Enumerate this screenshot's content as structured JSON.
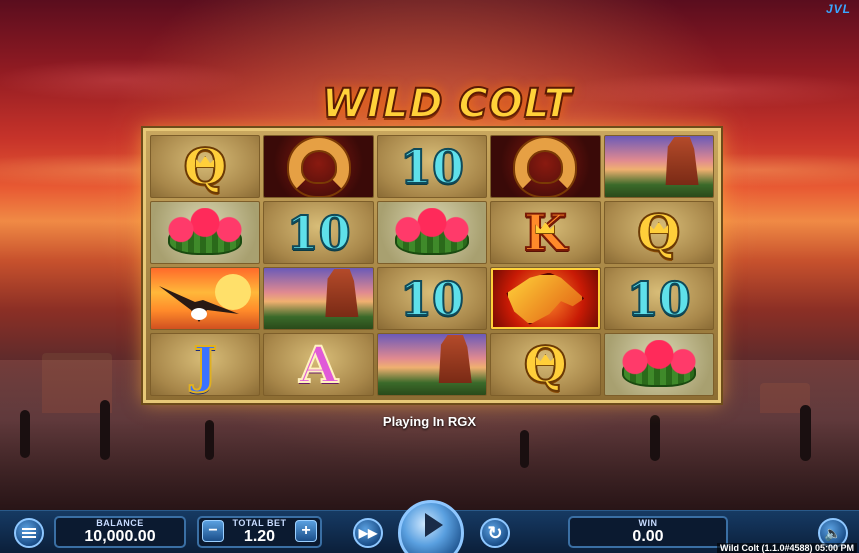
{
  "brand": {
    "logo_text": "JVL"
  },
  "game": {
    "title": "WILD COLT"
  },
  "reels": [
    [
      {
        "symbol": "Q",
        "type": "letter"
      },
      {
        "symbol": "cactus-flower",
        "type": "picture"
      },
      {
        "symbol": "eagle",
        "type": "picture"
      },
      {
        "symbol": "J",
        "type": "letter"
      }
    ],
    [
      {
        "symbol": "horseshoe",
        "type": "picture"
      },
      {
        "symbol": "10",
        "type": "letter"
      },
      {
        "symbol": "mesa",
        "type": "picture"
      },
      {
        "symbol": "A",
        "type": "letter"
      }
    ],
    [
      {
        "symbol": "10",
        "type": "letter"
      },
      {
        "symbol": "cactus-flower",
        "type": "picture"
      },
      {
        "symbol": "10",
        "type": "letter"
      },
      {
        "symbol": "mesa",
        "type": "picture"
      }
    ],
    [
      {
        "symbol": "horseshoe",
        "type": "picture"
      },
      {
        "symbol": "K",
        "type": "letter"
      },
      {
        "symbol": "wild-horse",
        "type": "picture"
      },
      {
        "symbol": "Q",
        "type": "letter"
      }
    ],
    [
      {
        "symbol": "mesa",
        "type": "picture"
      },
      {
        "symbol": "Q",
        "type": "letter"
      },
      {
        "symbol": "10",
        "type": "letter"
      },
      {
        "symbol": "cactus-flower",
        "type": "picture"
      }
    ]
  ],
  "status": {
    "message": "Playing In RGX"
  },
  "controls": {
    "menu_icon": "menu-icon",
    "balance": {
      "label": "BALANCE",
      "value": "10,000.00"
    },
    "total_bet": {
      "label": "TOTAL BET",
      "value": "1.20",
      "minus": "−",
      "plus": "+"
    },
    "fast_forward_icon": "fast-forward-icon",
    "spin_icon": "play-icon",
    "autoplay_icon": "autoplay-icon",
    "win": {
      "label": "WIN",
      "value": "0.00"
    },
    "sound_icon": "speaker-icon"
  },
  "footer": {
    "version": "Wild Colt (1.1.0#4588) 05:00 PM"
  },
  "colors": {
    "bar": "#163a63",
    "panel_border": "#3a6fa4",
    "title_gold": "#ffd23a"
  }
}
